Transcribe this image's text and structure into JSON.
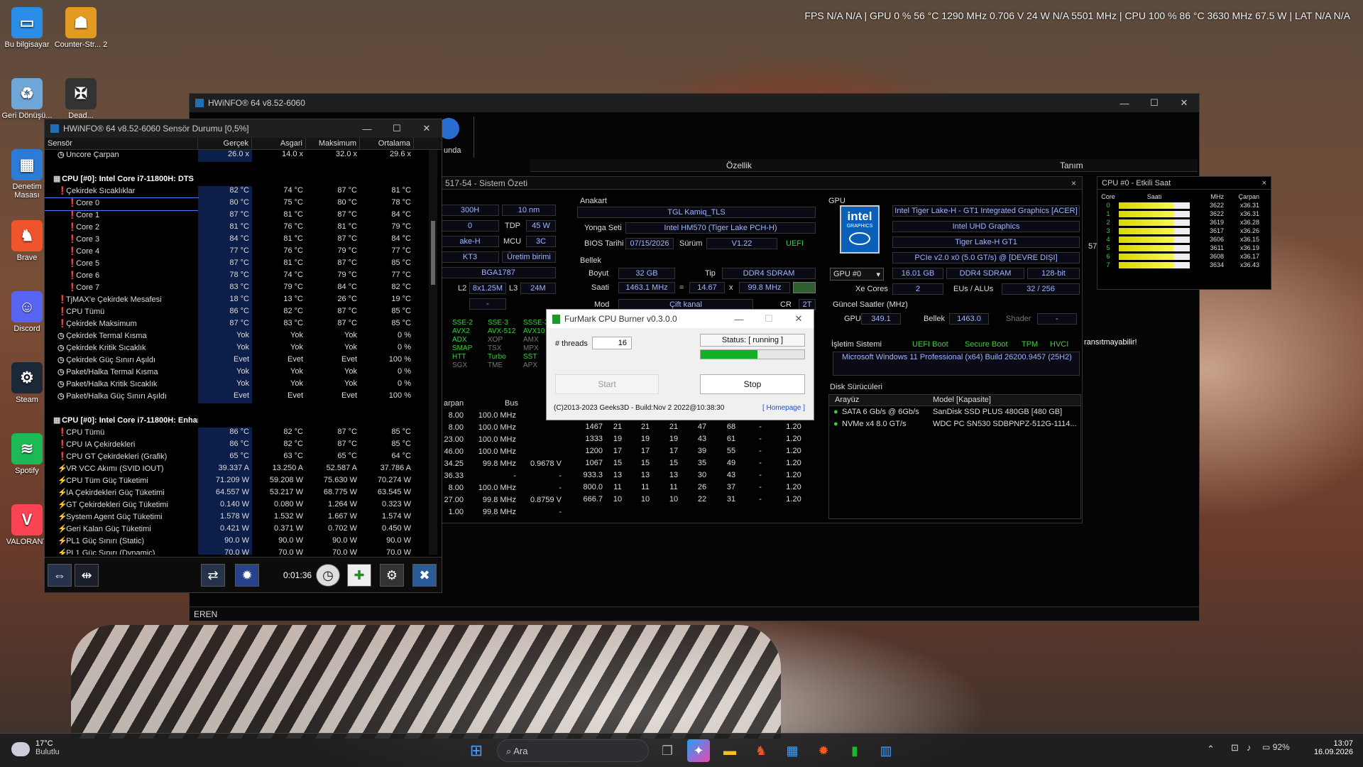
{
  "osd": {
    "text": "FPS N/A N/A | GPU 0 % 56 °C 1290 MHz 0.706 V 24 W N/A 5501 MHz | CPU 100 % 86 °C 3630 MHz 67.5 W | LAT N/A N/A"
  },
  "desktop": [
    {
      "label": "Bu bilgisayar",
      "icon": "monitor-icon",
      "glyph": "▭",
      "color": "#2a8ee8"
    },
    {
      "label": "Counter-Str... 2",
      "icon": "counter-strike-icon",
      "glyph": "☗",
      "color": "#e39a21"
    },
    {
      "label": "Geri Dönüşü...",
      "icon": "recycle-bin-icon",
      "glyph": "♻",
      "color": "#6fa7d8"
    },
    {
      "label": "Dead...",
      "icon": "game-icon",
      "glyph": "✠",
      "color": "#333"
    },
    {
      "label": "Denetim Masası",
      "icon": "control-panel-icon",
      "glyph": "▦",
      "color": "#2c7bd6"
    },
    {
      "label": "Brave",
      "icon": "brave-icon",
      "glyph": "♞",
      "color": "#f0542b"
    },
    {
      "label": "Discord",
      "icon": "discord-icon",
      "glyph": "☺",
      "color": "#5865f2"
    },
    {
      "label": "Steam",
      "icon": "steam-icon",
      "glyph": "⚙",
      "color": "#1b2838"
    },
    {
      "label": "Spotify",
      "icon": "spotify-icon",
      "glyph": "≋",
      "color": "#1db954"
    },
    {
      "label": "VALORANT",
      "icon": "valorant-icon",
      "glyph": "V",
      "color": "#fa4454"
    }
  ],
  "main": {
    "title": "HWiNFO® 64 v8.52-6060",
    "fragment": "unda",
    "col_feature": "Özellik",
    "col_desc": "Tanım",
    "status": "EREN"
  },
  "sensor": {
    "title": "HWiNFO® 64 v8.52-6060 Sensör Durumu [0,5%]",
    "headers": [
      "Sensör",
      "Gerçek",
      "Asgari",
      "Maksimum",
      "Ortalama"
    ],
    "rows": [
      {
        "i": 1,
        "m": "c",
        "name": "Uncore Çarpan",
        "v": [
          "26.0 x",
          "14.0 x",
          "32.0 x",
          "29.6 x"
        ]
      },
      {
        "i": 0,
        "m": "",
        "name": "",
        "v": [
          "",
          "",
          "",
          ""
        ]
      },
      {
        "i": 0,
        "m": "g",
        "name": "CPU [#0]: Intel Core i7-11800H: DTS",
        "v": [
          "",
          "",
          "",
          ""
        ],
        "grp": true
      },
      {
        "i": 1,
        "m": "r",
        "name": "Çekirdek Sıcaklıklar",
        "v": [
          "82 °C",
          "74 °C",
          "87 °C",
          "81 °C"
        ]
      },
      {
        "i": 2,
        "m": "r",
        "name": "Core 0",
        "v": [
          "80 °C",
          "75 °C",
          "80 °C",
          "78 °C"
        ],
        "sel": true
      },
      {
        "i": 2,
        "m": "r",
        "name": "Core 1",
        "v": [
          "87 °C",
          "81 °C",
          "87 °C",
          "84 °C"
        ]
      },
      {
        "i": 2,
        "m": "r",
        "name": "Core 2",
        "v": [
          "81 °C",
          "76 °C",
          "81 °C",
          "79 °C"
        ]
      },
      {
        "i": 2,
        "m": "r",
        "name": "Core 3",
        "v": [
          "84 °C",
          "81 °C",
          "87 °C",
          "84 °C"
        ]
      },
      {
        "i": 2,
        "m": "r",
        "name": "Core 4",
        "v": [
          "77 °C",
          "76 °C",
          "79 °C",
          "77 °C"
        ]
      },
      {
        "i": 2,
        "m": "r",
        "name": "Core 5",
        "v": [
          "87 °C",
          "81 °C",
          "87 °C",
          "85 °C"
        ]
      },
      {
        "i": 2,
        "m": "r",
        "name": "Core 6",
        "v": [
          "78 °C",
          "74 °C",
          "79 °C",
          "77 °C"
        ]
      },
      {
        "i": 2,
        "m": "r",
        "name": "Core 7",
        "v": [
          "83 °C",
          "79 °C",
          "84 °C",
          "82 °C"
        ]
      },
      {
        "i": 1,
        "m": "r",
        "name": "TjMAX'e Çekirdek Mesafesi",
        "v": [
          "18 °C",
          "13 °C",
          "26 °C",
          "19 °C"
        ]
      },
      {
        "i": 1,
        "m": "r",
        "name": "CPU Tümü",
        "v": [
          "86 °C",
          "82 °C",
          "87 °C",
          "85 °C"
        ]
      },
      {
        "i": 1,
        "m": "r",
        "name": "Çekirdek Maksimum",
        "v": [
          "87 °C",
          "83 °C",
          "87 °C",
          "85 °C"
        ]
      },
      {
        "i": 1,
        "m": "c",
        "name": "Çekirdek Termal Kısma",
        "v": [
          "Yok",
          "Yok",
          "Yok",
          "0 %"
        ]
      },
      {
        "i": 1,
        "m": "c",
        "name": "Çekirdek Kritik Sıcaklık",
        "v": [
          "Yok",
          "Yok",
          "Yok",
          "0 %"
        ]
      },
      {
        "i": 1,
        "m": "c",
        "name": "Çekirdek Güç Sınırı Aşıldı",
        "v": [
          "Evet",
          "Evet",
          "Evet",
          "100 %"
        ]
      },
      {
        "i": 1,
        "m": "c",
        "name": "Paket/Halka Termal Kısma",
        "v": [
          "Yok",
          "Yok",
          "Yok",
          "0 %"
        ]
      },
      {
        "i": 1,
        "m": "c",
        "name": "Paket/Halka Kritik Sıcaklık",
        "v": [
          "Yok",
          "Yok",
          "Yok",
          "0 %"
        ]
      },
      {
        "i": 1,
        "m": "c",
        "name": "Paket/Halka Güç Sınırı Aşıldı",
        "v": [
          "Evet",
          "Evet",
          "Evet",
          "100 %"
        ]
      },
      {
        "i": 0,
        "m": "",
        "name": "",
        "v": [
          "",
          "",
          "",
          ""
        ]
      },
      {
        "i": 0,
        "m": "g",
        "name": "CPU [#0]: Intel Core i7-11800H: Enhanced",
        "v": [
          "",
          "",
          "",
          ""
        ],
        "grp": true
      },
      {
        "i": 1,
        "m": "r",
        "name": "CPU Tümü",
        "v": [
          "86 °C",
          "82 °C",
          "87 °C",
          "85 °C"
        ]
      },
      {
        "i": 1,
        "m": "r",
        "name": "CPU IA Çekirdekleri",
        "v": [
          "86 °C",
          "82 °C",
          "87 °C",
          "85 °C"
        ]
      },
      {
        "i": 1,
        "m": "r",
        "name": "CPU GT Çekirdekleri (Grafik)",
        "v": [
          "65 °C",
          "63 °C",
          "65 °C",
          "64 °C"
        ]
      },
      {
        "i": 1,
        "m": "y",
        "name": "VR VCC Akımı (SVID IOUT)",
        "v": [
          "39.337 A",
          "13.250 A",
          "52.587 A",
          "37.786 A"
        ]
      },
      {
        "i": 1,
        "m": "y",
        "name": "CPU Tüm Güç Tüketimi",
        "v": [
          "71.209 W",
          "59.208 W",
          "75.630 W",
          "70.274 W"
        ]
      },
      {
        "i": 1,
        "m": "y",
        "name": "IA Çekirdekleri Güç Tüketimi",
        "v": [
          "64.557 W",
          "53.217 W",
          "68.775 W",
          "63.545 W"
        ]
      },
      {
        "i": 1,
        "m": "y",
        "name": "GT Çekirdekleri Güç Tüketimi",
        "v": [
          "0.140 W",
          "0.080 W",
          "1.264 W",
          "0.323 W"
        ]
      },
      {
        "i": 1,
        "m": "y",
        "name": "System Agent Güç Tüketimi",
        "v": [
          "1.578 W",
          "1.532 W",
          "1.667 W",
          "1.574 W"
        ]
      },
      {
        "i": 1,
        "m": "y",
        "name": "Geri Kalan Güç Tüketimi",
        "v": [
          "0.421 W",
          "0.371 W",
          "0.702 W",
          "0.450 W"
        ]
      },
      {
        "i": 1,
        "m": "y",
        "name": "PL1 Güç Sınırı (Static)",
        "v": [
          "90.0 W",
          "90.0 W",
          "90.0 W",
          "90.0 W"
        ]
      },
      {
        "i": 1,
        "m": "y",
        "name": "PL1 Güç Sınırı (Dynamic)",
        "v": [
          "70.0 W",
          "70.0 W",
          "70.0 W",
          "70.0 W"
        ]
      }
    ],
    "timer": "0:01:36"
  },
  "summary": {
    "title": "517-54 - Sistem Özeti",
    "cpu": {
      "a": "300H",
      "b": "10 nm",
      "c": "0",
      "tdp_l": "TDP",
      "tdp": "45 W",
      "d": "ake-H",
      "mcu_l": "MCU",
      "mcu": "3C",
      "e": "KT3",
      "f": "Üretim birimi",
      "g": "BGA1787",
      "l2_l": "L2",
      "l2": "8x1.25M",
      "l3_l": "L3",
      "l3": "24M",
      "dash": "-"
    },
    "features": [
      [
        "SSE-2",
        "SSE-3",
        "SSSE-3"
      ],
      [
        "AVX2",
        "AVX-512",
        "AVX10"
      ],
      [
        "ADX",
        "XOP",
        "AMX"
      ],
      [
        "SMAP",
        "TSX",
        "MPX"
      ],
      [
        "HTT",
        "Turbo",
        "SST"
      ],
      [
        "SGX",
        "TME",
        "APX"
      ]
    ],
    "mobo": {
      "t": "Anakart",
      "name": "TGL Kamiq_TLS",
      "chip_l": "Yonga Seti",
      "chip": "Intel HM570 (Tiger Lake PCH-H)",
      "bios_l": "BIOS Tarihi",
      "bios": "07/15/2026",
      "ver_l": "Sürüm",
      "ver": "V1.22",
      "uefi": "UEFI"
    },
    "mem": {
      "t": "Bellek",
      "size_l": "Boyut",
      "size": "32 GB",
      "type_l": "Tip",
      "type": "DDR4 SDRAM",
      "clk_l": "Saati",
      "clk": "1463.1 MHz",
      "eq": "=",
      "mult": "14.67",
      "x": "x",
      "base": "99.8 MHz",
      "mode_l": "Mod",
      "mode": "Çift kanal",
      "cr_l": "CR",
      "cr": "2T"
    },
    "gpu": {
      "t": "GPU",
      "name": "Intel Tiger Lake-H - GT1 Integrated Graphics [ACER]",
      "sub": "Intel UHD Graphics",
      "core": "Tiger Lake-H GT1",
      "bus": "PCIe v2.0 x0 (5.0 GT/s) @ [DEVRE DIŞI]",
      "sel": "GPU #0",
      "vram": "16.01 GB",
      "vtype": "DDR4 SDRAM",
      "width": "128-bit",
      "xe_l": "Xe Cores",
      "xe": "2",
      "eu_l": "EUs / ALUs",
      "eu": "32 / 256",
      "clk_t": "Güncel Saatler (MHz)",
      "gpu_l": "GPU",
      "gpu": "349.1",
      "mem_l": "Bellek",
      "mem": "1463.0",
      "sh_l": "Shader",
      "sh": "-",
      "logo": "intel",
      "logo_sub": "GRAPHICS"
    },
    "os": {
      "t": "İşletim Sistemi",
      "f1": "UEFI Boot",
      "f2": "Secure Boot",
      "f3": "TPM",
      "f4": "HVCI",
      "name": "Microsoft Windows 11 Professional (x64) Build 26200.9457 (25H2)"
    },
    "disk": {
      "t": "Disk Sürücüleri",
      "h1": "Arayüz",
      "h2": "Model [Kapasite]",
      "rows": [
        [
          "SATA 6 Gb/s @ 6Gb/s",
          "SanDisk SSD PLUS 480GB [480 GB]"
        ],
        [
          "NVMe x4 8.0 GT/s",
          "WDC PC SN530 SDBPNPZ-512G-1114..."
        ]
      ]
    },
    "left_table": {
      "h1": "arpan",
      "h2": "Bus",
      "rows": [
        [
          "8.00",
          "100.0 MHz",
          ""
        ],
        [
          "8.00",
          "100.0 MHz",
          ""
        ],
        [
          "23.00",
          "100.0 MHz",
          ""
        ],
        [
          "46.00",
          "100.0 MHz",
          ""
        ],
        [
          "34.25",
          "99.8 MHz",
          "0.9678 V"
        ],
        [
          "36.33",
          "-",
          "-"
        ],
        [
          "8.00",
          "100.0 MHz",
          "-"
        ],
        [
          "27.00",
          "99.8 MHz",
          "0.8759 V"
        ],
        [
          "1.00",
          "99.8 MHz",
          "-"
        ]
      ]
    },
    "clk_table": [
      [
        "1467",
        "21",
        "21",
        "21",
        "47",
        "68",
        "-",
        "1.20"
      ],
      [
        "1333",
        "19",
        "19",
        "19",
        "43",
        "61",
        "-",
        "1.20"
      ],
      [
        "1200",
        "17",
        "17",
        "17",
        "39",
        "55",
        "-",
        "1.20"
      ],
      [
        "1067",
        "15",
        "15",
        "15",
        "35",
        "49",
        "-",
        "1.20"
      ],
      [
        "933.3",
        "13",
        "13",
        "13",
        "30",
        "43",
        "-",
        "1.20"
      ],
      [
        "800.0",
        "11",
        "11",
        "11",
        "26",
        "37",
        "-",
        "1.20"
      ],
      [
        "666.7",
        "10",
        "10",
        "10",
        "22",
        "31",
        "-",
        "1.20"
      ]
    ],
    "side_text": "ransıtmayabilir!",
    "side57": "57"
  },
  "furmark": {
    "title": "FurMark CPU Burner v0.3.0.0",
    "threads_l": "# threads",
    "threads": "16",
    "status": "Status: [ running ]",
    "progress": 0.55,
    "start": "Start",
    "stop": "Stop",
    "footer": "(C)2013-2023 Geeks3D - Build:Nov  2 2022@10:38:30",
    "home": "[ Homepage ]"
  },
  "effclock": {
    "title": "CPU #0 - Etkili Saat",
    "h": [
      "Core",
      "Saati",
      "MHz",
      "Çarpan"
    ],
    "cores": [
      {
        "c": "0",
        "mhz": "3622",
        "mul": "x36.31",
        "f": 0.97
      },
      {
        "c": "1",
        "mhz": "3622",
        "mul": "x36.31",
        "f": 0.97
      },
      {
        "c": "2",
        "mhz": "3619",
        "mul": "x36.28",
        "f": 0.97
      },
      {
        "c": "3",
        "mhz": "3617",
        "mul": "x36.26",
        "f": 0.97
      },
      {
        "c": "4",
        "mhz": "3606",
        "mul": "x36.15",
        "f": 0.96
      },
      {
        "c": "5",
        "mhz": "3611",
        "mul": "x36.19",
        "f": 0.96
      },
      {
        "c": "6",
        "mhz": "3608",
        "mul": "x36.17",
        "f": 0.96
      },
      {
        "c": "7",
        "mhz": "3634",
        "mul": "x36.43",
        "f": 0.97
      }
    ]
  },
  "taskbar": {
    "weather_temp": "17°C",
    "weather_desc": "Bulutlu",
    "search": "Ara",
    "battery": "92%",
    "time": "13:07",
    "date": "16.09.2026"
  }
}
